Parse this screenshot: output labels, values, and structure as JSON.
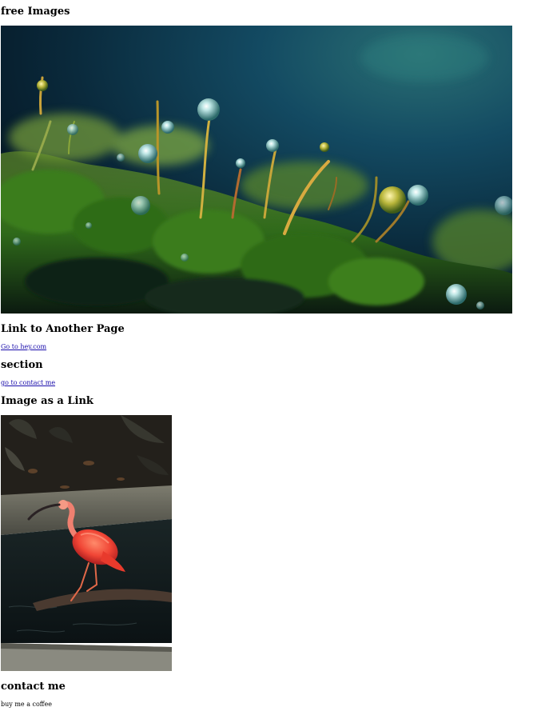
{
  "headings": {
    "free_images": "free Images",
    "link_to_another_page": "Link to Another Page",
    "section": "section",
    "image_as_link": "Image as a Link",
    "contact_me": "contact me"
  },
  "links": {
    "hey": "Go to hey.com",
    "contact": "go to contact me"
  },
  "text": {
    "buy_coffee": "buy me a coffee"
  },
  "images": {
    "moss": "moss-with-water-droplets-image",
    "ibis": "scarlet-ibis-image"
  }
}
